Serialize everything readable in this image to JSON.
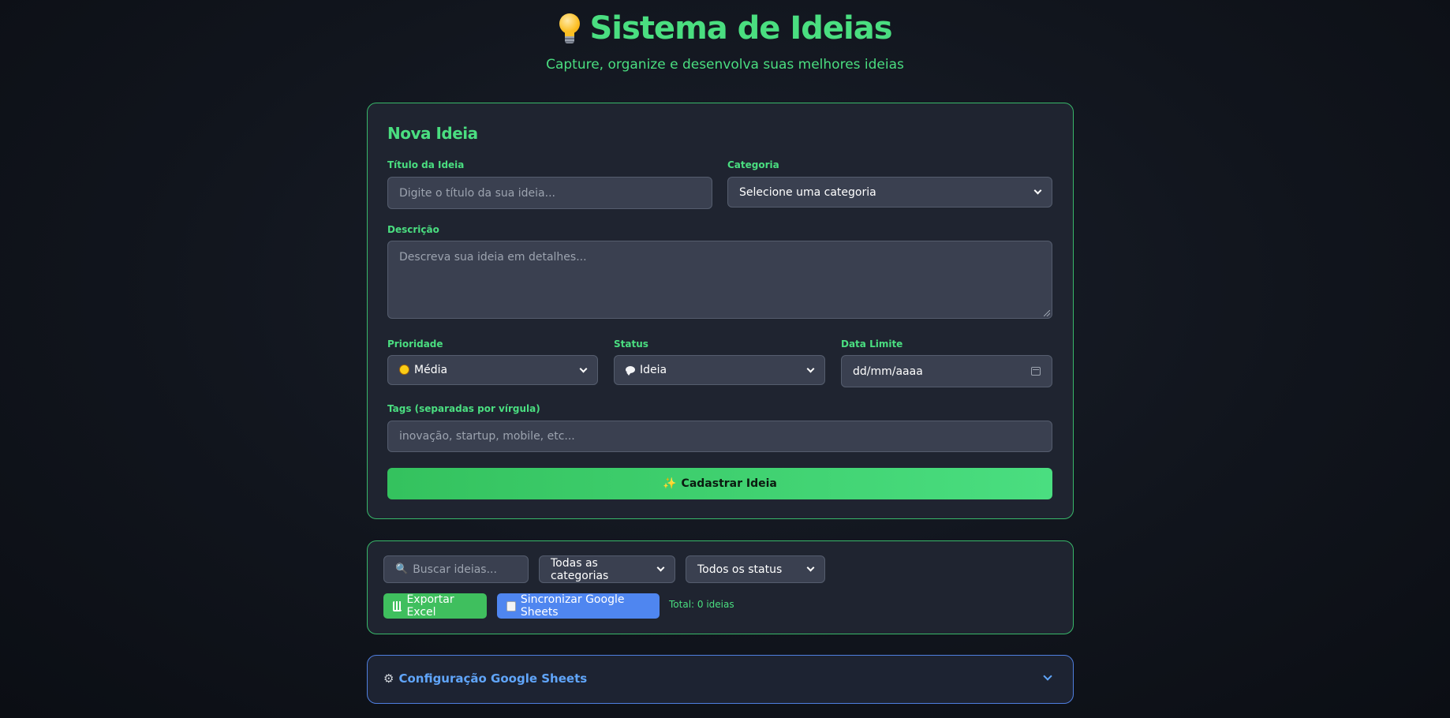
{
  "header": {
    "title": "Sistema de Ideias",
    "subtitle": "Capture, organize e desenvolva suas melhores ideias",
    "icon": "lightbulb-icon"
  },
  "form": {
    "heading": "Nova Ideia",
    "title_label": "Título da Ideia",
    "title_placeholder": "Digite o título da sua ideia...",
    "category_label": "Categoria",
    "category_value": "Selecione uma categoria",
    "description_label": "Descrição",
    "description_placeholder": "Descreva sua ideia em detalhes...",
    "priority_label": "Prioridade",
    "priority_value": "Média",
    "status_label": "Status",
    "status_value": "Ideia",
    "deadline_label": "Data Limite",
    "deadline_value": "dd/mm/aaaa",
    "tags_label": "Tags (separadas por vírgula)",
    "tags_placeholder": "inovação, startup, mobile, etc...",
    "submit_label": "Cadastrar Ideia"
  },
  "filters": {
    "search_placeholder": "Buscar ideias...",
    "category_value": "Todas as categorias",
    "status_value": "Todos os status",
    "export_label": "Exportar Excel",
    "sync_label": "Sincronizar Google Sheets",
    "total_label": "Total: 0 ideias"
  },
  "config": {
    "title": "Configuração Google Sheets"
  },
  "colors": {
    "accent": "#4ade80",
    "blue": "#4f86f0",
    "card_bg": "#1f2430"
  }
}
